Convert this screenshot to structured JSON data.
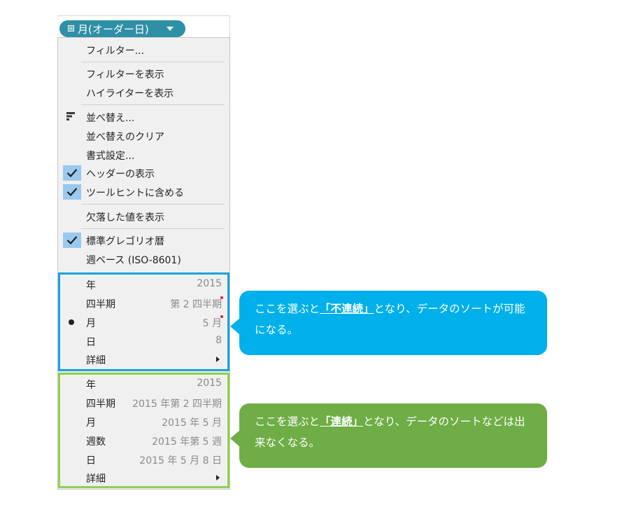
{
  "pill": {
    "label": "月(オーダー日)",
    "expand_glyph": "⊞"
  },
  "menu": {
    "items": [
      {
        "label": "フィルター..."
      },
      {
        "label": "フィルターを表示"
      },
      {
        "label": "ハイライターを表示"
      },
      {
        "label": "並べ替え...",
        "icon": "sort-icon"
      },
      {
        "label": "並べ替えのクリア"
      },
      {
        "label": "書式設定..."
      },
      {
        "label": "ヘッダーの表示",
        "checked": true
      },
      {
        "label": "ツールヒントに含める",
        "checked": true
      },
      {
        "label": "欠落した値を表示"
      },
      {
        "label": "標準グレゴリオ暦",
        "checked": true
      },
      {
        "label": "週ベース (ISO-8601)"
      }
    ],
    "discrete": [
      {
        "label": "年",
        "value": "2015"
      },
      {
        "label": "四半期",
        "value": "第 2 四半期"
      },
      {
        "label": "月",
        "value": "5 月",
        "selected": true
      },
      {
        "label": "日",
        "value": "8"
      },
      {
        "label": "詳細",
        "submenu": true
      }
    ],
    "continuous": [
      {
        "label": "年",
        "value": "2015"
      },
      {
        "label": "四半期",
        "value": "2015 年第 2 四半期"
      },
      {
        "label": "月",
        "value": "2015 年 5 月"
      },
      {
        "label": "週数",
        "value": "2015 年第 5 週"
      },
      {
        "label": "日",
        "value": "2015 年 5 月 8 日"
      },
      {
        "label": "詳細",
        "submenu": true
      }
    ]
  },
  "callouts": {
    "blue": {
      "pre": "ここを選ぶと",
      "emph": "「不連続」",
      "post": "となり、データのソートが可能になる。",
      "color": "#00b0ea"
    },
    "green": {
      "pre": "ここを選ぶと",
      "emph": "「連続」",
      "post": "となり、データのソートなどは出来なくなる。",
      "color": "#6fad46"
    }
  },
  "colors": {
    "pill": "#2f8fa6",
    "discrete_border": "#1aa3da",
    "continuous_border": "#8ed14f",
    "check_highlight": "#99c9ee"
  }
}
